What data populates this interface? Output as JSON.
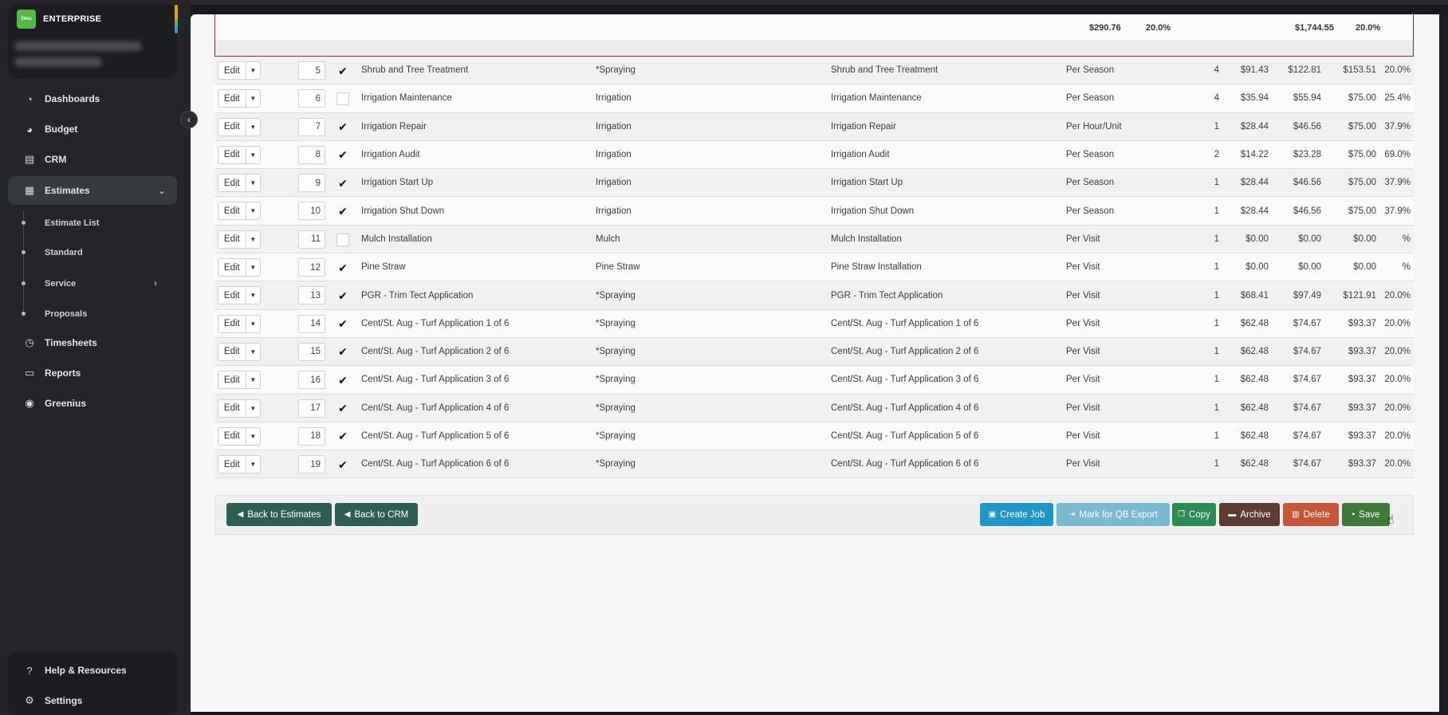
{
  "brand": {
    "logo_text": "Oms",
    "name": "ENTERPRISE"
  },
  "sidebar": {
    "items": [
      {
        "label": "Dashboards",
        "icon": "dashboard-icon"
      },
      {
        "label": "Budget",
        "icon": "pie-chart-icon"
      },
      {
        "label": "CRM",
        "icon": "contact-icon"
      },
      {
        "label": "Estimates",
        "icon": "calculator-icon"
      },
      {
        "label": "Timesheets",
        "icon": "clock-icon"
      },
      {
        "label": "Reports",
        "icon": "report-icon"
      },
      {
        "label": "Greenius",
        "icon": "play-circle-icon"
      }
    ],
    "estimates_sub": [
      "Estimate List",
      "Standard",
      "Service",
      "Proposals"
    ],
    "bottom": [
      {
        "label": "Help & Resources",
        "icon": "help-icon"
      },
      {
        "label": "Settings",
        "icon": "gear-icon"
      }
    ]
  },
  "summary": {
    "total_1": "$290.76",
    "pct_1": "20.0%",
    "total_2": "$1,744.55",
    "pct_2": "20.0%"
  },
  "table": {
    "edit_label": "Edit",
    "rows": [
      {
        "num": "5",
        "checked": true,
        "name": "Shrub and Tree Treatment",
        "category": "*Spraying",
        "desc": "Shrub and Tree Treatment",
        "freq": "Per Season",
        "qty": "4",
        "cost": "$91.43",
        "mid": "$122.81",
        "price": "$153.51",
        "pct": "20.0%"
      },
      {
        "num": "6",
        "checked": false,
        "name": "Irrigation Maintenance",
        "category": "Irrigation",
        "desc": "Irrigation Maintenance",
        "freq": "Per Season",
        "qty": "4",
        "cost": "$35.94",
        "mid": "$55.94",
        "price": "$75.00",
        "pct": "25.4%"
      },
      {
        "num": "7",
        "checked": true,
        "name": "Irrigation Repair",
        "category": "Irrigation",
        "desc": "Irrigation Repair",
        "freq": "Per Hour/Unit",
        "qty": "1",
        "cost": "$28.44",
        "mid": "$46.56",
        "price": "$75.00",
        "pct": "37.9%"
      },
      {
        "num": "8",
        "checked": true,
        "name": "Irrigation Audit",
        "category": "Irrigation",
        "desc": "Irrigation Audit",
        "freq": "Per Season",
        "qty": "2",
        "cost": "$14.22",
        "mid": "$23.28",
        "price": "$75.00",
        "pct": "69.0%"
      },
      {
        "num": "9",
        "checked": true,
        "name": "Irrigation Start Up",
        "category": "Irrigation",
        "desc": "Irrigation Start Up",
        "freq": "Per Season",
        "qty": "1",
        "cost": "$28.44",
        "mid": "$46.56",
        "price": "$75.00",
        "pct": "37.9%"
      },
      {
        "num": "10",
        "checked": true,
        "name": "Irrigation Shut Down",
        "category": "Irrigation",
        "desc": "Irrigation Shut Down",
        "freq": "Per Season",
        "qty": "1",
        "cost": "$28.44",
        "mid": "$46.56",
        "price": "$75.00",
        "pct": "37.9%"
      },
      {
        "num": "11",
        "checked": false,
        "name": "Mulch Installation",
        "category": "Mulch",
        "desc": "Mulch Installation",
        "freq": "Per Visit",
        "qty": "1",
        "cost": "$0.00",
        "mid": "$0.00",
        "price": "$0.00",
        "pct": "%"
      },
      {
        "num": "12",
        "checked": true,
        "name": "Pine Straw",
        "category": "Pine Straw",
        "desc": "Pine Straw Installation",
        "freq": "Per Visit",
        "qty": "1",
        "cost": "$0.00",
        "mid": "$0.00",
        "price": "$0.00",
        "pct": "%"
      },
      {
        "num": "13",
        "checked": true,
        "name": "PGR - Trim Tect Application",
        "category": "*Spraying",
        "desc": "PGR - Trim Tect Application",
        "freq": "Per Visit",
        "qty": "1",
        "cost": "$68.41",
        "mid": "$97.49",
        "price": "$121.91",
        "pct": "20.0%"
      },
      {
        "num": "14",
        "checked": true,
        "name": "Cent/St. Aug - Turf Application 1 of 6",
        "category": "*Spraying",
        "desc": "Cent/St. Aug - Turf Application 1 of 6",
        "freq": "Per Visit",
        "qty": "1",
        "cost": "$62.48",
        "mid": "$74.67",
        "price": "$93.37",
        "pct": "20.0%"
      },
      {
        "num": "15",
        "checked": true,
        "name": "Cent/St. Aug - Turf Application 2 of 6",
        "category": "*Spraying",
        "desc": "Cent/St. Aug - Turf Application 2 of 6",
        "freq": "Per Visit",
        "qty": "1",
        "cost": "$62.48",
        "mid": "$74.67",
        "price": "$93.37",
        "pct": "20.0%"
      },
      {
        "num": "16",
        "checked": true,
        "name": "Cent/St. Aug - Turf Application 3 of 6",
        "category": "*Spraying",
        "desc": "Cent/St. Aug - Turf Application 3 of 6",
        "freq": "Per Visit",
        "qty": "1",
        "cost": "$62.48",
        "mid": "$74.67",
        "price": "$93.37",
        "pct": "20.0%"
      },
      {
        "num": "17",
        "checked": true,
        "name": "Cent/St. Aug - Turf Application 4 of 6",
        "category": "*Spraying",
        "desc": "Cent/St. Aug - Turf Application 4 of 6",
        "freq": "Per Visit",
        "qty": "1",
        "cost": "$62.48",
        "mid": "$74.67",
        "price": "$93.37",
        "pct": "20.0%"
      },
      {
        "num": "18",
        "checked": true,
        "name": "Cent/St. Aug - Turf Application 5 of 6",
        "category": "*Spraying",
        "desc": "Cent/St. Aug - Turf Application 5 of 6",
        "freq": "Per Visit",
        "qty": "1",
        "cost": "$62.48",
        "mid": "$74.67",
        "price": "$93.37",
        "pct": "20.0%"
      },
      {
        "num": "19",
        "checked": true,
        "name": "Cent/St. Aug - Turf Application 6 of 6",
        "category": "*Spraying",
        "desc": "Cent/St. Aug - Turf Application 6 of 6",
        "freq": "Per Visit",
        "qty": "1",
        "cost": "$62.48",
        "mid": "$74.67",
        "price": "$93.37",
        "pct": "20.0%"
      }
    ]
  },
  "actions": {
    "back_estimates": "Back to Estimates",
    "back_crm": "Back to CRM",
    "create_job": "Create Job",
    "mark_qb": "Mark for QB Export",
    "copy": "Copy",
    "archive": "Archive",
    "delete": "Delete",
    "save": "Save"
  }
}
